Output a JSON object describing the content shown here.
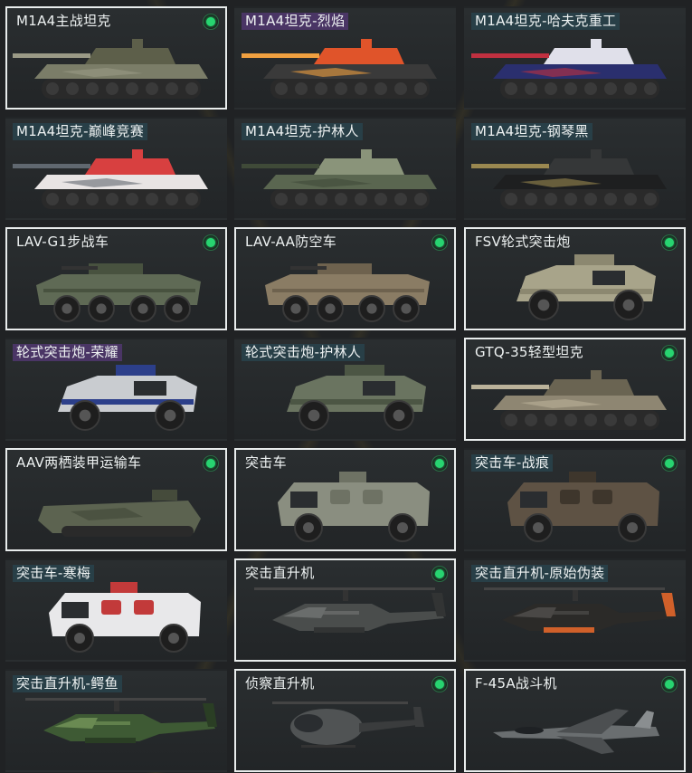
{
  "vehicles": [
    {
      "name": "M1A4主战坦克",
      "owned": true,
      "selected": true,
      "tag": "none",
      "kind": "tank",
      "colors": [
        "#7b7d68",
        "#5d5f4a",
        "#9a9a86"
      ]
    },
    {
      "name": "M1A4坦克-烈焰",
      "owned": false,
      "selected": false,
      "tag": "purple",
      "kind": "tank",
      "colors": [
        "#3a3a3a",
        "#e0542a",
        "#f0a040"
      ]
    },
    {
      "name": "M1A4坦克-哈夫克重工",
      "owned": false,
      "selected": false,
      "tag": "teal",
      "kind": "tank",
      "colors": [
        "#2a2f6e",
        "#e0e0ea",
        "#c03040"
      ]
    },
    {
      "name": "M1A4坦克-巅峰竞赛",
      "owned": false,
      "selected": false,
      "tag": "teal",
      "kind": "tank",
      "colors": [
        "#e8e4e4",
        "#d84040",
        "#606870"
      ]
    },
    {
      "name": "M1A4坦克-护林人",
      "owned": false,
      "selected": false,
      "tag": "teal",
      "kind": "tank",
      "colors": [
        "#5a6650",
        "#8a947a",
        "#3f4a38"
      ]
    },
    {
      "name": "M1A4坦克-钢琴黑",
      "owned": false,
      "selected": false,
      "tag": "teal",
      "kind": "tank",
      "colors": [
        "#1e1f20",
        "#353738",
        "#9a8850"
      ]
    },
    {
      "name": "LAV-G1步战车",
      "owned": true,
      "selected": true,
      "tag": "none",
      "kind": "apc",
      "colors": [
        "#5f6a55",
        "#48523f",
        "#2c2c2c"
      ]
    },
    {
      "name": "LAV-AA防空车",
      "owned": true,
      "selected": true,
      "tag": "none",
      "kind": "apc",
      "colors": [
        "#8a7c64",
        "#6e624e",
        "#2c2c2c"
      ]
    },
    {
      "name": "FSV轮式突击炮",
      "owned": true,
      "selected": true,
      "tag": "none",
      "kind": "mrap",
      "colors": [
        "#a8a48a",
        "#8c8870",
        "#2a2a2a"
      ]
    },
    {
      "name": "轮式突击炮-荣耀",
      "owned": false,
      "selected": false,
      "tag": "purple",
      "kind": "mrap",
      "colors": [
        "#c9ccd0",
        "#2c3f8a",
        "#2a2a2a"
      ]
    },
    {
      "name": "轮式突击炮-护林人",
      "owned": false,
      "selected": false,
      "tag": "teal",
      "kind": "mrap",
      "colors": [
        "#6a7460",
        "#4c5644",
        "#2a2a2a"
      ]
    },
    {
      "name": "GTQ-35轻型坦克",
      "owned": true,
      "selected": true,
      "tag": "none",
      "kind": "tank",
      "colors": [
        "#8e8672",
        "#6a6452",
        "#bab29a"
      ]
    },
    {
      "name": "AAV两栖装甲运输车",
      "owned": true,
      "selected": true,
      "tag": "none",
      "kind": "aav",
      "colors": [
        "#5c6350",
        "#454b3b",
        "#2c2c2c"
      ]
    },
    {
      "name": "突击车",
      "owned": true,
      "selected": true,
      "tag": "none",
      "kind": "truck",
      "colors": [
        "#8a8e80",
        "#6e7264",
        "#2a2a2a"
      ]
    },
    {
      "name": "突击车-战痕",
      "owned": true,
      "selected": false,
      "tag": "teal",
      "kind": "truck",
      "colors": [
        "#5e5244",
        "#3e362c",
        "#2a2a2a"
      ]
    },
    {
      "name": "突击车-寒梅",
      "owned": false,
      "selected": false,
      "tag": "teal",
      "kind": "truck",
      "colors": [
        "#e8e8ea",
        "#c23a3a",
        "#2a2a2a"
      ]
    },
    {
      "name": "突击直升机",
      "owned": true,
      "selected": true,
      "tag": "none",
      "kind": "heli",
      "colors": [
        "#4a4d4c",
        "#323434",
        "#6a6d6c"
      ]
    },
    {
      "name": "突击直升机-原始伪装",
      "owned": false,
      "selected": false,
      "tag": "teal",
      "kind": "heli",
      "colors": [
        "#2b2a28",
        "#d0602a",
        "#4a4846"
      ]
    },
    {
      "name": "突击直升机-鳄鱼",
      "owned": false,
      "selected": false,
      "tag": "teal",
      "kind": "heli",
      "colors": [
        "#3e5a34",
        "#2a3e24",
        "#6a8a52"
      ]
    },
    {
      "name": "侦察直升机",
      "owned": true,
      "selected": true,
      "tag": "none",
      "kind": "scout",
      "colors": [
        "#505354",
        "#3a3c3d",
        "#6c6f70"
      ]
    },
    {
      "name": "F-45A战斗机",
      "owned": true,
      "selected": true,
      "tag": "none",
      "kind": "jet",
      "colors": [
        "#6a6e70",
        "#4c4f51",
        "#8a8e90"
      ]
    }
  ]
}
